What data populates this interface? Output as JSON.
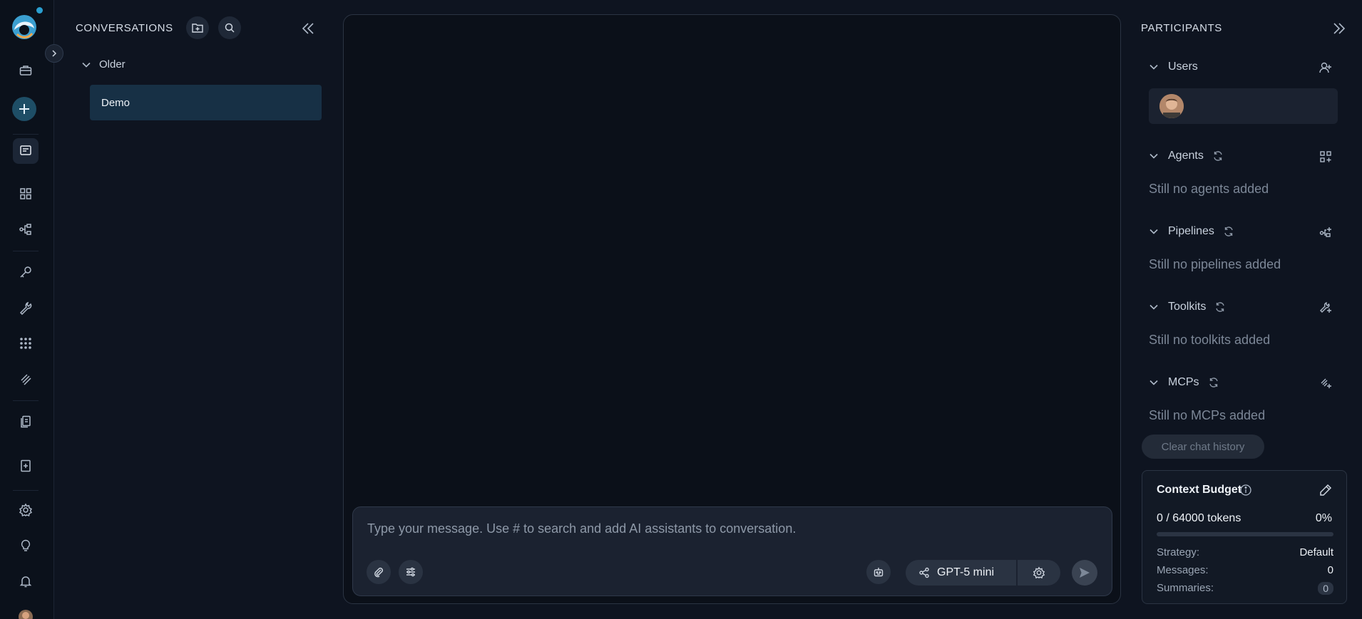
{
  "conversations": {
    "title": "CONVERSATIONS",
    "group_label": "Older",
    "items": [
      {
        "label": "Demo"
      }
    ]
  },
  "chat": {
    "placeholder": "Type your message. Use # to search and add AI assistants to conversation.",
    "model_label": "GPT-5 mini"
  },
  "participants": {
    "title": "PARTICIPANTS",
    "sections": {
      "users": {
        "label": "Users"
      },
      "agents": {
        "label": "Agents",
        "empty": "Still no agents added"
      },
      "pipelines": {
        "label": "Pipelines",
        "empty": "Still no pipelines added"
      },
      "toolkits": {
        "label": "Toolkits",
        "empty": "Still no toolkits added"
      },
      "mcps": {
        "label": "MCPs",
        "empty": "Still no MCPs added"
      }
    },
    "clear_label": "Clear chat history"
  },
  "budget": {
    "title": "Context Budget",
    "tokens": "0 / 64000 tokens",
    "percent": "0%",
    "fill_fraction": 0,
    "strategy_label": "Strategy:",
    "strategy_value": "Default",
    "messages_label": "Messages:",
    "messages_value": "0",
    "summaries_label": "Summaries:",
    "summaries_value": "0"
  },
  "colors": {
    "accent": "#2a9fd0",
    "selected_item": "#173045",
    "background": "#0e1420"
  }
}
